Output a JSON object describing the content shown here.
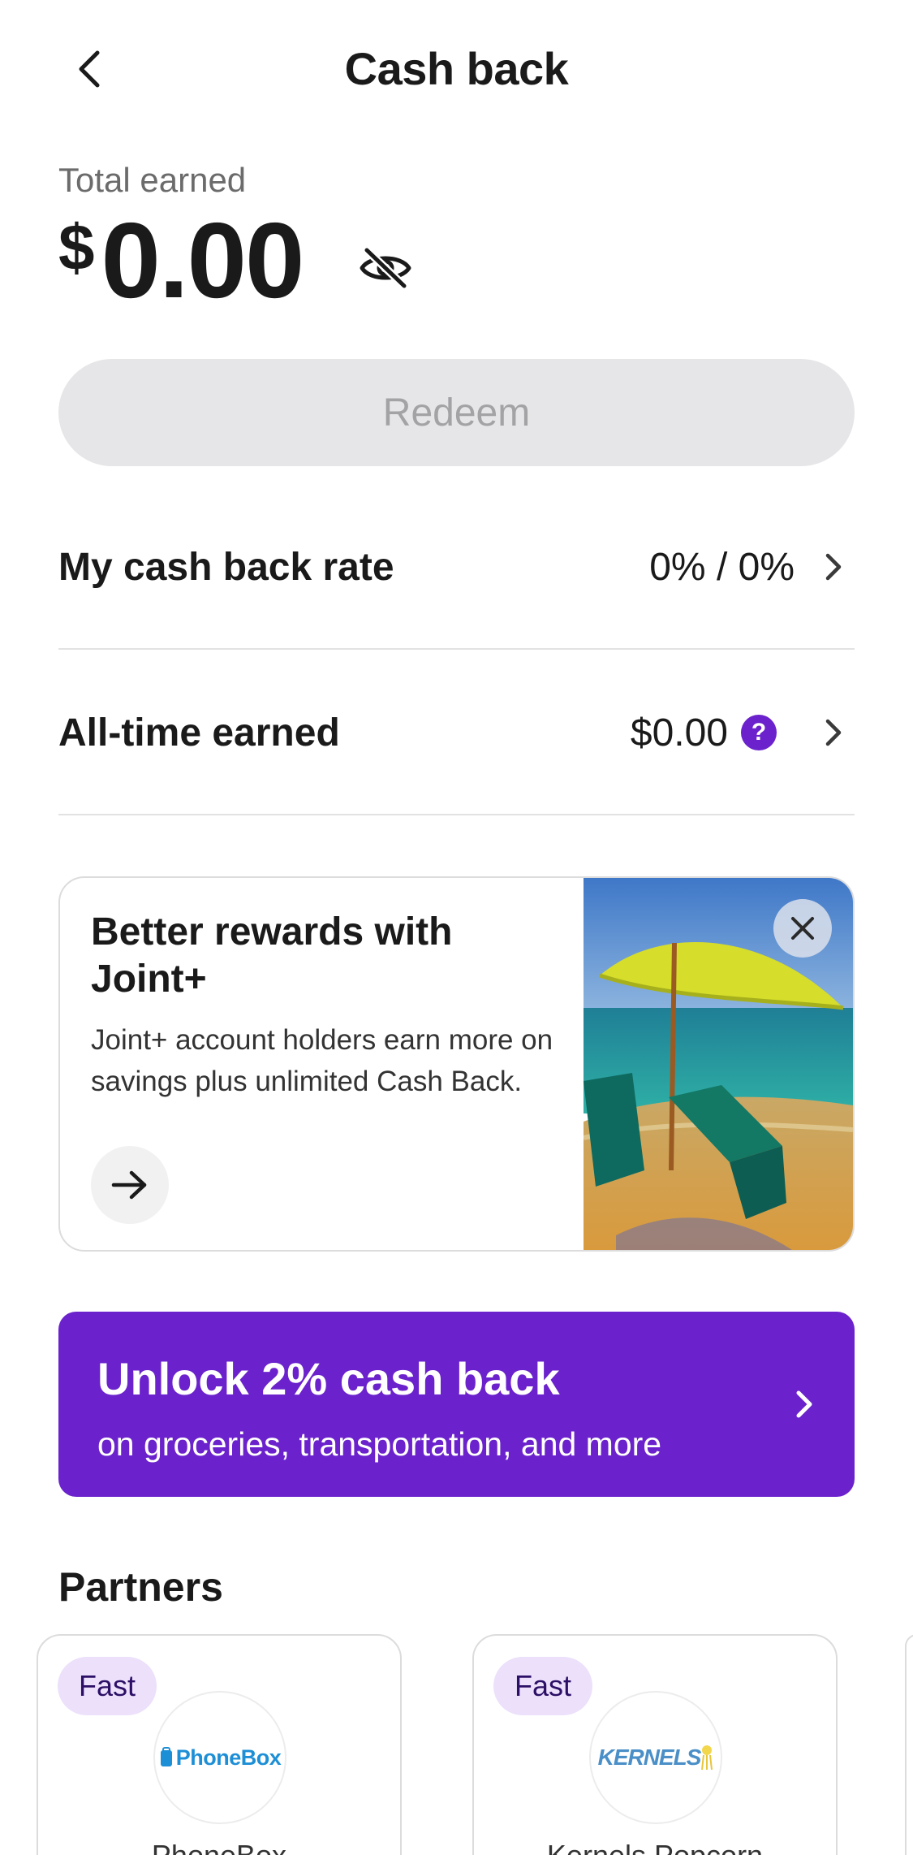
{
  "header": {
    "title": "Cash back"
  },
  "total": {
    "label": "Total earned",
    "currency": "$",
    "amount": "0.00"
  },
  "redeem": {
    "label": "Redeem"
  },
  "rows": {
    "rate": {
      "label": "My cash back rate",
      "value": "0% / 0%"
    },
    "alltime": {
      "label": "All-time earned",
      "value": "$0.00",
      "help": "?"
    }
  },
  "promo": {
    "title": "Better rewards with Joint+",
    "body": "Joint+ account holders earn more on savings plus unlimited Cash Back."
  },
  "unlock": {
    "title": "Unlock 2% cash back",
    "subtitle": "on groceries, transportation, and more"
  },
  "partners": {
    "title": "Partners",
    "items": [
      {
        "badge": "Fast",
        "logo_text": "PhoneBox",
        "name": "PhoneBox"
      },
      {
        "badge": "Fast",
        "logo_text": "KERNELS",
        "name": "Kernels Popcorn"
      }
    ]
  },
  "colors": {
    "accent": "#6b22cc",
    "badge_bg": "#ece0fb",
    "redeem_disabled_bg": "#e6e6e8"
  }
}
